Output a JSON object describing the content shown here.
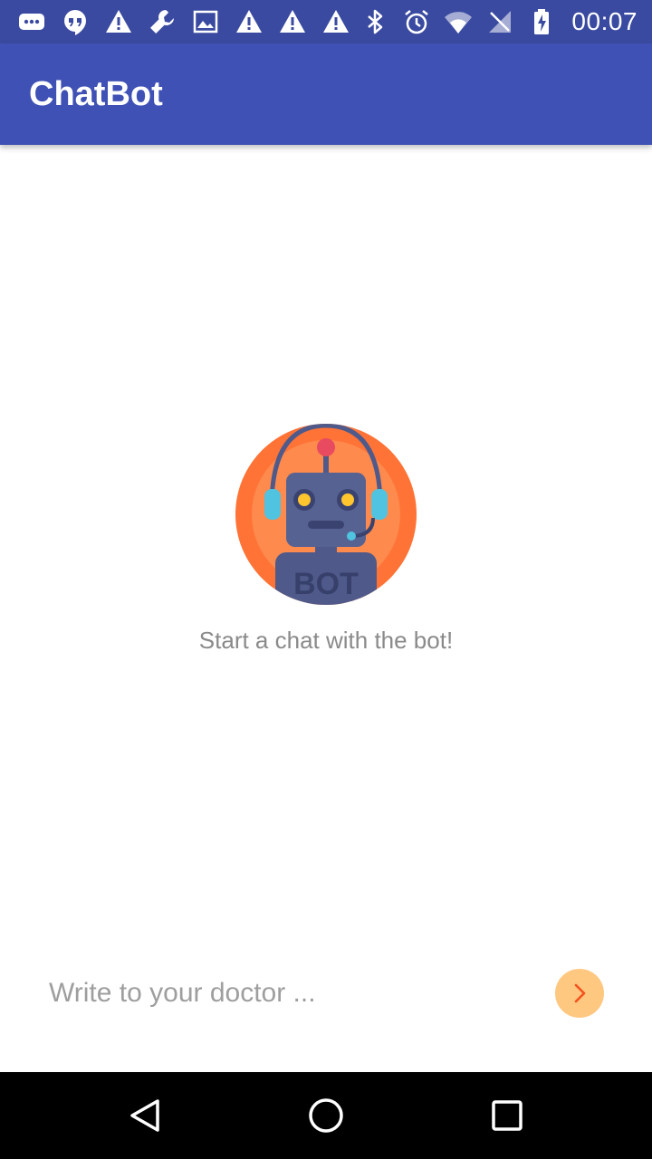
{
  "status_bar": {
    "time": "00:07",
    "left_icons": [
      "messages-icon",
      "hangouts-icon",
      "warning-icon",
      "wrench-icon",
      "image-icon",
      "warning-icon",
      "warning-icon",
      "warning-icon"
    ],
    "right_icons": [
      "bluetooth-icon",
      "alarm-icon",
      "wifi-icon",
      "no-signal-icon",
      "battery-charging-icon"
    ],
    "background": "#3a4aa0"
  },
  "app_bar": {
    "title": "ChatBot",
    "color": "#3f51b5"
  },
  "empty_state": {
    "avatar_label": "BOT",
    "message": "Start a chat with the bot!"
  },
  "composer": {
    "placeholder": "Write to your doctor ...",
    "value": "",
    "send_color": "#ffc880",
    "send_arrow_color": "#f4511e"
  },
  "nav_bar": {
    "buttons": [
      "back-icon",
      "home-icon",
      "recents-icon"
    ]
  }
}
